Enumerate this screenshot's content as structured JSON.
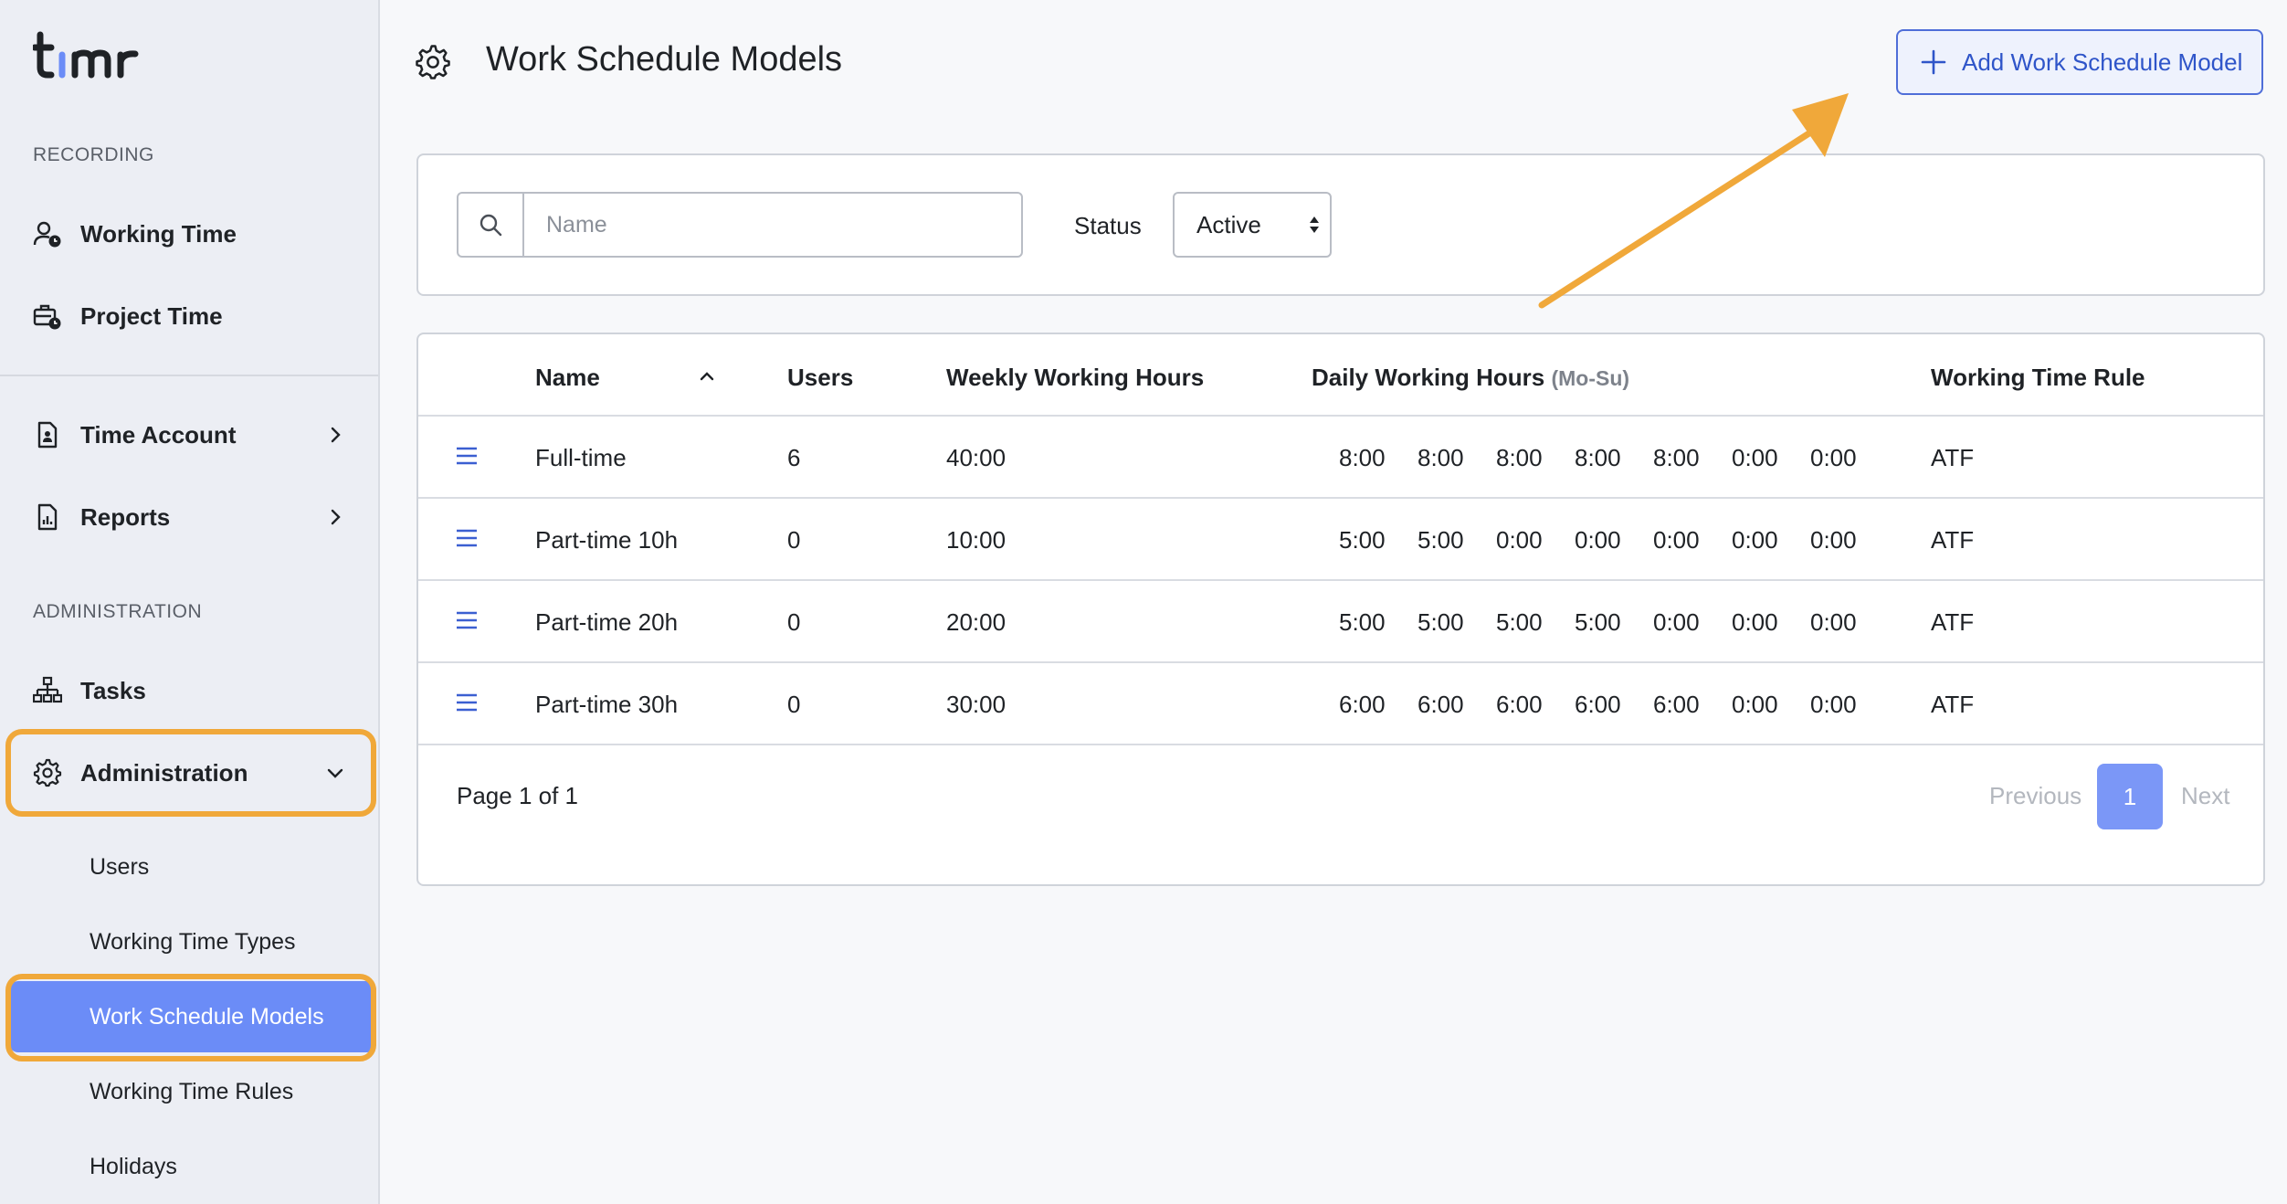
{
  "app": {
    "logo_text": "timr"
  },
  "sidebar": {
    "recording_label": "RECORDING",
    "administration_label": "ADMINISTRATION",
    "recording_items": [
      {
        "label": "Working Time",
        "icon": "user-clock-icon"
      },
      {
        "label": "Project Time",
        "icon": "briefcase-clock-icon"
      }
    ],
    "report_items": [
      {
        "label": "Time Account",
        "icon": "document-icon"
      },
      {
        "label": "Reports",
        "icon": "chart-document-icon"
      }
    ],
    "admin_items": [
      {
        "label": "Tasks",
        "icon": "hierarchy-icon"
      },
      {
        "label": "Administration",
        "icon": "gear-icon"
      }
    ],
    "sub_items": [
      {
        "label": "Users"
      },
      {
        "label": "Working Time Types"
      },
      {
        "label": "Work Schedule Models"
      },
      {
        "label": "Working Time Rules"
      },
      {
        "label": "Holidays"
      }
    ]
  },
  "header": {
    "title": "Work Schedule Models",
    "add_button": "Add Work Schedule Model"
  },
  "filters": {
    "search_placeholder": "Name",
    "status_label": "Status",
    "status_value": "Active"
  },
  "table": {
    "columns": {
      "name": "Name",
      "users": "Users",
      "weekly": "Weekly Working Hours",
      "daily": "Daily Working Hours",
      "daily_suffix": "(Mo-Su)",
      "rule": "Working Time Rule"
    },
    "rows": [
      {
        "name": "Full-time",
        "users": "6",
        "weekly": "40:00",
        "daily": [
          "8:00",
          "8:00",
          "8:00",
          "8:00",
          "8:00",
          "0:00",
          "0:00"
        ],
        "rule": "ATF"
      },
      {
        "name": "Part-time 10h",
        "users": "0",
        "weekly": "10:00",
        "daily": [
          "5:00",
          "5:00",
          "0:00",
          "0:00",
          "0:00",
          "0:00",
          "0:00"
        ],
        "rule": "ATF"
      },
      {
        "name": "Part-time 20h",
        "users": "0",
        "weekly": "20:00",
        "daily": [
          "5:00",
          "5:00",
          "5:00",
          "5:00",
          "0:00",
          "0:00",
          "0:00"
        ],
        "rule": "ATF"
      },
      {
        "name": "Part-time 30h",
        "users": "0",
        "weekly": "30:00",
        "daily": [
          "6:00",
          "6:00",
          "6:00",
          "6:00",
          "6:00",
          "0:00",
          "0:00"
        ],
        "rule": "ATF"
      }
    ]
  },
  "pagination": {
    "info": "Page 1 of 1",
    "previous": "Previous",
    "current": "1",
    "next": "Next"
  },
  "colors": {
    "accent": "#6b8cf7",
    "highlight": "#f0a83a",
    "button_text": "#2f55c9"
  }
}
